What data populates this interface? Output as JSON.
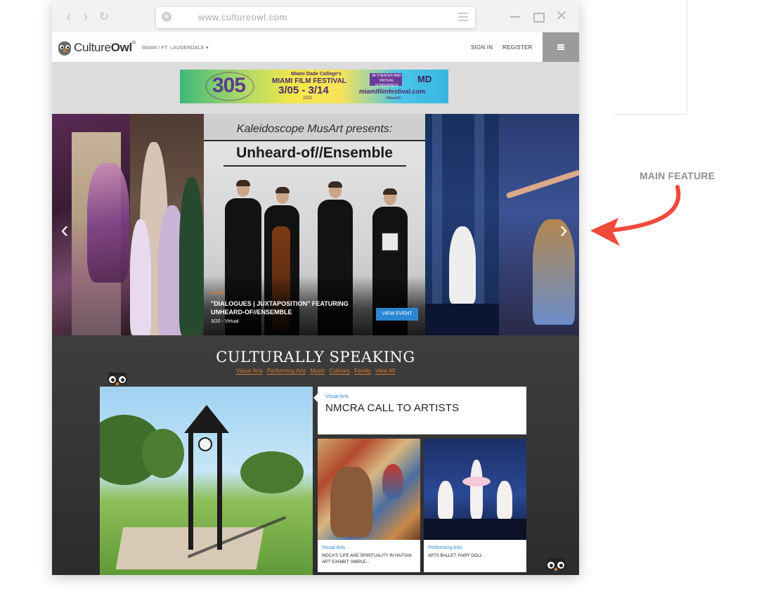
{
  "browser": {
    "url": "www.cultureowl.com"
  },
  "header": {
    "brand_light": "Culture",
    "brand_bold": "Owl",
    "brand_mark": "®",
    "city": "MIAMI / FT. LAUDERDALE",
    "city_caret": "▾",
    "sign_in": "SIGN IN",
    "register": "REGISTER"
  },
  "banner_ad": {
    "number": "305",
    "line1": "Miami Dade College's",
    "line2": "MIAMI FILM FESTIVAL",
    "dates": "3/05 - 3/14",
    "year": "2021",
    "badge": "IN-THEATER AND VIRTUAL SCREENINGS",
    "url": "miamifilmfestival.com",
    "tag": "#MiamiFF",
    "logo": "MD"
  },
  "slider": {
    "kicker": "Kaleidoscope MusArt presents:",
    "headline": "Unheard-of//Ensemble",
    "category": "Music",
    "event_title": "\"DIALOGUES | JUXTAPOSITION\" FEATURING UNHEARD-OF//ENSEMBLE",
    "event_date": "3/20 - Virtual",
    "view_event": "VIEW EVENT",
    "prev_arrow": "‹",
    "next_arrow": "›"
  },
  "culture": {
    "title": "CULTURALLY SPEAKING",
    "categories": [
      "Visual Arts",
      "Performing Arts",
      "Music",
      "Culinary",
      "Family",
      "View All"
    ],
    "feature": {
      "category": "Visual Arts",
      "title": "NMCRA CALL TO ARTISTS"
    },
    "cards": [
      {
        "category": "Visual Arts",
        "title": "MOCA'S 'LIFE AND SPIRITUALITY IN HAITIAN ART' EXHIBIT: SIMPLE..."
      },
      {
        "category": "Performing Arts",
        "title": "ARTS BALLET: FAIRY DOLL"
      }
    ]
  },
  "annotation": {
    "label": "MAIN FEATURE",
    "arrow_color": "#f04a3a"
  },
  "colors": {
    "accent_orange": "#e07b27",
    "link_blue": "#2a86d3"
  }
}
